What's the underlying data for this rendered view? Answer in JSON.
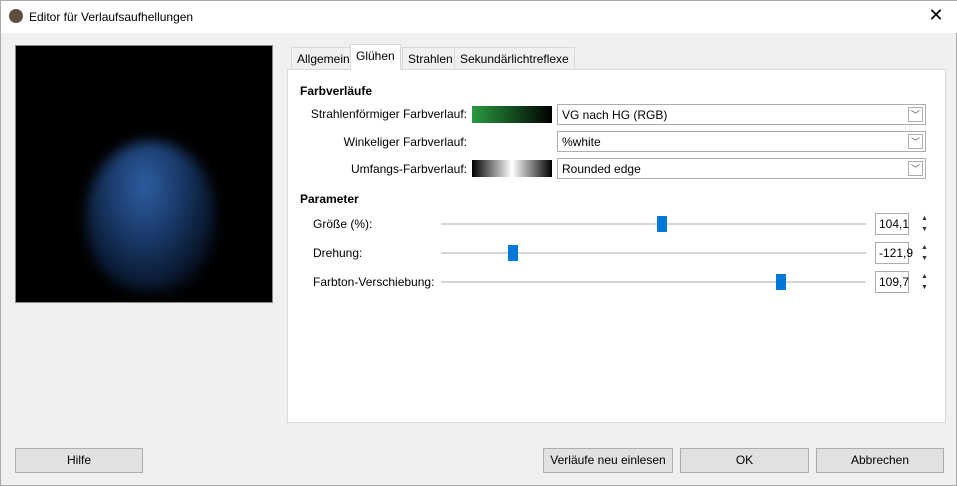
{
  "window": {
    "title": "Editor für Verlaufsaufhellungen",
    "close": "✕"
  },
  "tabs": [
    {
      "label": "Allgemein"
    },
    {
      "label": "Glühen"
    },
    {
      "label": "Strahlen"
    },
    {
      "label": "Sekundärlichtreflexe"
    }
  ],
  "active_tab": "Glühen",
  "gradients": {
    "heading": "Farbverläufe",
    "radial": {
      "label": "Strahlenförmiger Farbverlauf:",
      "value": "VG nach HG (RGB)"
    },
    "angular": {
      "label": "Winkeliger Farbverlauf:",
      "value": "%white"
    },
    "size": {
      "label": "Umfangs-Farbverlauf:",
      "value": "Rounded edge"
    }
  },
  "parameters": {
    "heading": "Parameter",
    "items": [
      {
        "label": "Größe (%):",
        "value": "104,1",
        "fraction": 0.52
      },
      {
        "label": "Drehung:",
        "value": "-121,9",
        "fraction": 0.17
      },
      {
        "label": "Farbton-Verschiebung:",
        "value": "109,7",
        "fraction": 0.8
      }
    ]
  },
  "buttons": {
    "help": "Hilfe",
    "reload": "Verläufe neu einlesen",
    "ok": "OK",
    "cancel": "Abbrechen"
  },
  "colors": {
    "accent": "#0078d7"
  }
}
